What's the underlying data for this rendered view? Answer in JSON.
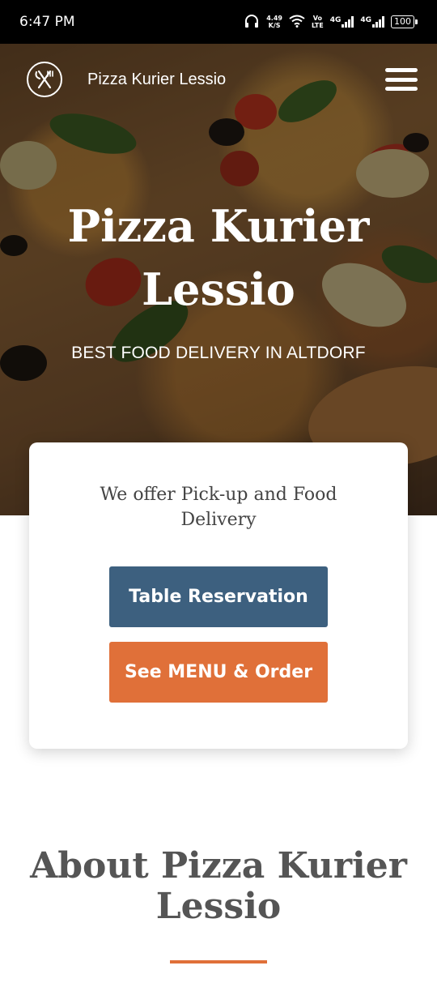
{
  "status_bar": {
    "time": "6:47 PM",
    "speed_value": "4.49",
    "speed_unit": "K/S",
    "volte_top": "Vo",
    "volte_bottom": "LTE",
    "network1": "4G",
    "network2": "4G",
    "battery": "100"
  },
  "nav": {
    "brand": "Pizza Kurier Lessio",
    "logo_icon": "fork-knife-icon",
    "menu_icon": "hamburger-menu-icon"
  },
  "hero": {
    "title_line1": "Pizza Kurier",
    "title_line2": "Lessio",
    "subtitle": "BEST FOOD DELIVERY IN ALTDORF"
  },
  "card": {
    "text": "We offer Pick-up and Food Delivery",
    "reserve_label": "Table Reservation",
    "menu_label": "See MENU & Order"
  },
  "about": {
    "title": "About Pizza Kurier Lessio"
  },
  "colors": {
    "accent_orange": "#e07039",
    "button_blue": "#3d607f"
  }
}
